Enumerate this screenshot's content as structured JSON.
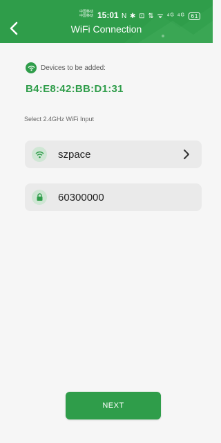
{
  "status_bar": {
    "carrier_line1": "中国移动",
    "carrier_line2": "中国移动",
    "time": "15:01",
    "icons_text": "N ✱ ⊡ ⇅ ᯤ ⁴ᴳ ⁴ᴳ",
    "battery": "61"
  },
  "header": {
    "title": "WiFi Connection",
    "back_icon": "chevron-left-icon"
  },
  "devices": {
    "label": "Devices to be added:",
    "device_id": "B4:E8:42:BB:D1:31"
  },
  "wifi_select": {
    "label": "Select 2.4GHz WiFi Input",
    "ssid": "szpace",
    "password": "60300000"
  },
  "footer": {
    "next_label": "NEXT"
  },
  "colors": {
    "accent": "#2f9d4a",
    "field_bg": "#eaeaea",
    "page_bg": "#f6f6f6"
  }
}
